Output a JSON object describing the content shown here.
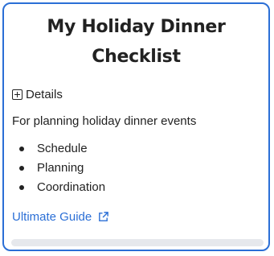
{
  "card": {
    "title": "My Holiday Dinner Checklist",
    "details_label": "Details",
    "description": "For planning holiday dinner events",
    "items": [
      "Schedule",
      "Planning",
      "Coordination"
    ],
    "link_label": "Ultimate Guide"
  },
  "icons": {
    "details": "plus-square-icon",
    "link": "external-link-icon"
  },
  "colors": {
    "accent": "#2b6fd6",
    "text": "#222222",
    "scrollbar": "#e6e8ec"
  }
}
